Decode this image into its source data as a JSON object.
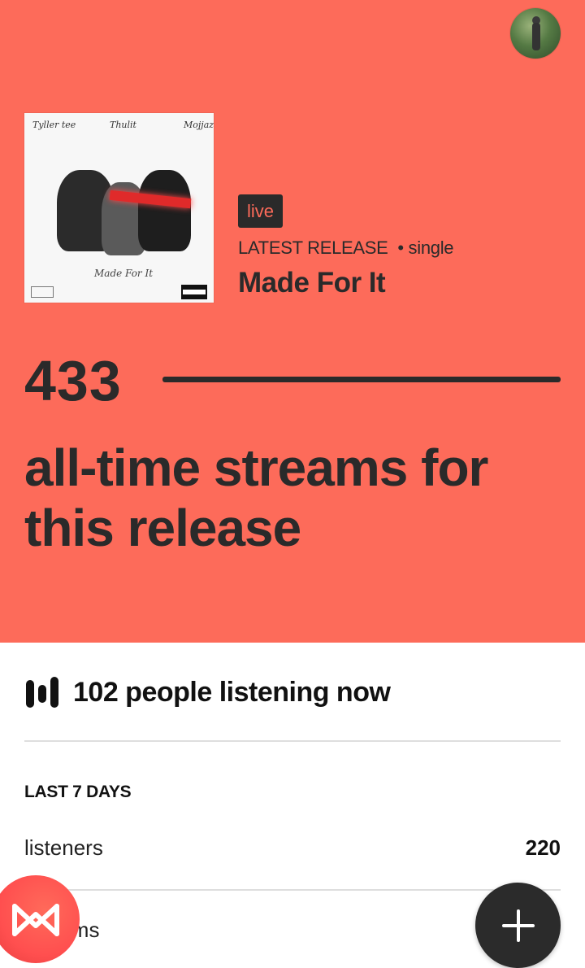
{
  "hero": {
    "badge": "live",
    "latest_label": "LATEST RELEASE",
    "separator": "•",
    "release_type": "single",
    "release_title": "Made For It",
    "cover": {
      "artists": [
        "Tyller tee",
        "Thulit",
        "Mojjaz"
      ],
      "script_title": "Made For It"
    },
    "streams_count": "433",
    "streams_text": "all-time streams for this release"
  },
  "live": {
    "text": "102 people listening now"
  },
  "stats": {
    "section_label": "LAST 7 DAYS",
    "rows": [
      {
        "label": "listeners",
        "value": "220"
      },
      {
        "label": "streams",
        "value": ""
      }
    ]
  },
  "icons": {
    "avatar": "profile-avatar",
    "brand": "audiomack-logo-icon",
    "add": "plus-icon",
    "bars": "equalizer-bars-icon"
  },
  "colors": {
    "hero_bg": "#fd6b5a",
    "text_dark": "#2a2a2a",
    "fab_dark": "#2b2b2b"
  }
}
